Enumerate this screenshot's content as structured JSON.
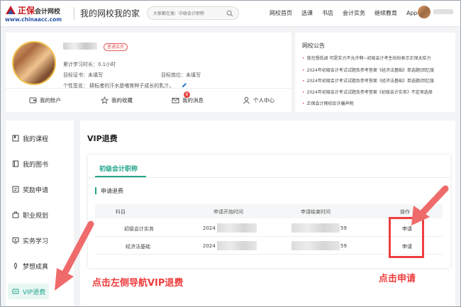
{
  "header": {
    "brand": "正保",
    "brand_sub": "会计网校",
    "url": "www.chinaacc.com",
    "slogan": "我的网校我的家",
    "search_placeholder": "大家都在搜：中级会计职称",
    "nav": [
      "网校首页",
      "选课",
      "书店",
      "会计实务",
      "继续教育",
      "App看课"
    ]
  },
  "profile": {
    "badge": "普通会员",
    "study_time": "累计学习时长：0.1小时",
    "cert_label": "目标证书：未填写",
    "position_label": "目标岗位：未填写",
    "signature": "个性签名：  耕耘者的汗水是哺育种子成长的乳汁。",
    "actions": {
      "account": "我的账户",
      "favorites": "我的收藏",
      "messages": "我的消息",
      "messages_count": "6",
      "personal": "个人中心"
    }
  },
  "notices": {
    "title": "网校公告",
    "items": [
      "我也想低调 可是实力不允许啊~初级会计考生纷纷表示正保太给力",
      "2024年初级会计考试试题及参考答案《经济法基础》单选题(回忆版",
      "2024年初级会计考试试题及参考答案《经济法基础》单选题(回忆版",
      "2024年初级会计考试试题及参考答案《初级会计实务》不定项选择",
      "正保会计网校反诈骗声明"
    ]
  },
  "sidebar": {
    "items": [
      {
        "label": "我的课程",
        "icon": "course-icon"
      },
      {
        "label": "我的图书",
        "icon": "book-icon"
      },
      {
        "label": "奖励申请",
        "icon": "reward-icon"
      },
      {
        "label": "职业规划",
        "icon": "career-icon"
      },
      {
        "label": "实务学习",
        "icon": "practice-icon"
      },
      {
        "label": "梦想成真",
        "icon": "dream-icon"
      },
      {
        "label": "VIP退费",
        "icon": "vip-refund-icon"
      }
    ]
  },
  "main": {
    "title": "VIP退费",
    "tab": "初级会计职称",
    "section_title": "申请退费",
    "columns": [
      "科目",
      "申请开始时间",
      "申请结束时间",
      "操作"
    ],
    "rows": [
      {
        "subject": "初级会计实务",
        "start": "2024",
        "end": "59",
        "action": "申请"
      },
      {
        "subject": "经济法基础",
        "start": "2024",
        "end": "59",
        "action": "申请"
      }
    ]
  },
  "annotations": {
    "left": "点击左侧导航VIP退费",
    "right": "点击申请",
    "color": "#ef3c3c"
  },
  "colors": {
    "accent": "#22a58c",
    "brand_red": "#c8161d",
    "highlight": "#ef3f3f"
  }
}
